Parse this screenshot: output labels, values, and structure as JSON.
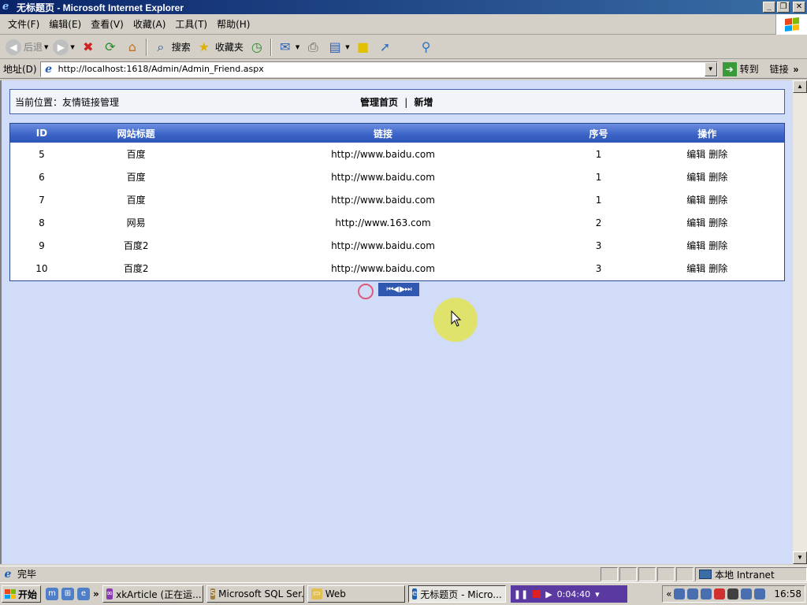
{
  "window": {
    "title": "无标题页 - Microsoft Internet Explorer",
    "buttons": [
      "minimize",
      "restore",
      "close"
    ]
  },
  "menubar": {
    "items": [
      "文件(F)",
      "编辑(E)",
      "查看(V)",
      "收藏(A)",
      "工具(T)",
      "帮助(H)"
    ]
  },
  "toolbar": {
    "back_label": "后退",
    "search_label": "搜索",
    "favorites_label": "收藏夹"
  },
  "address": {
    "label": "地址(D)",
    "url": "http://localhost:1618/Admin/Admin_Friend.aspx",
    "go_label": "转到",
    "links_label": "链接"
  },
  "page": {
    "location_text": "当前位置：友情链接管理",
    "nav_home": "管理首页",
    "nav_separator": "|",
    "nav_add": "新增",
    "table": {
      "headers": [
        "ID",
        "网站标题",
        "链接",
        "序号",
        "操作"
      ],
      "rows": [
        {
          "id": "5",
          "title": "百度",
          "url": "http://www.baidu.com",
          "seq": "1",
          "edit": "编辑",
          "delete": "删除"
        },
        {
          "id": "6",
          "title": "百度",
          "url": "http://www.baidu.com",
          "seq": "1",
          "edit": "编辑",
          "delete": "删除"
        },
        {
          "id": "7",
          "title": "百度",
          "url": "http://www.baidu.com",
          "seq": "1",
          "edit": "编辑",
          "delete": "删除"
        },
        {
          "id": "8",
          "title": "网易",
          "url": "http://www.163.com",
          "seq": "2",
          "edit": "编辑",
          "delete": "删除"
        },
        {
          "id": "9",
          "title": "百度2",
          "url": "http://www.baidu.com",
          "seq": "3",
          "edit": "编辑",
          "delete": "删除"
        },
        {
          "id": "10",
          "title": "百度2",
          "url": "http://www.baidu.com",
          "seq": "3",
          "edit": "编辑",
          "delete": "删除"
        }
      ]
    },
    "pager": "⏮◀ ▶⏭"
  },
  "statusbar": {
    "text": "完毕",
    "zone": "本地 Intranet"
  },
  "taskbar": {
    "start_label": "开始",
    "tasks": [
      {
        "label": "xkArticle (正在运...",
        "active": false
      },
      {
        "label": "Microsoft SQL Ser...",
        "active": false
      },
      {
        "label": "Web",
        "active": false
      },
      {
        "label": "无标题页 - Micro...",
        "active": true
      }
    ],
    "recorder_time": "0:04:40",
    "clock": "16:58"
  },
  "colors": {
    "content_bg": "#d0dcf8",
    "header_blue": "#3e66c8",
    "border_blue": "#2a4a90"
  }
}
